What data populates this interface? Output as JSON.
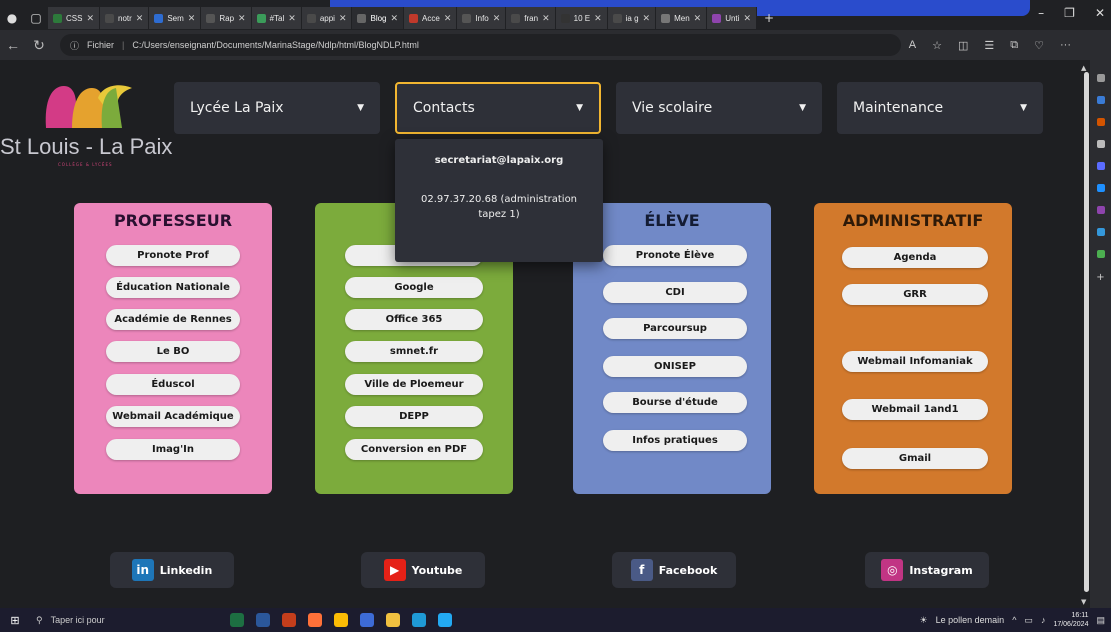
{
  "browser": {
    "tabs": [
      {
        "label": "CSS",
        "color": "#2d7a3b"
      },
      {
        "label": "notr",
        "color": "#4a4a4a"
      },
      {
        "label": "Sem",
        "color": "#2e6cd1"
      },
      {
        "label": "Rap",
        "color": "#555"
      },
      {
        "label": "#Tal",
        "color": "#3b9c5a"
      },
      {
        "label": "appi",
        "color": "#4a4a4a"
      },
      {
        "label": "Blog",
        "color": "#666",
        "active": true
      },
      {
        "label": "Acce",
        "color": "#c0392b"
      },
      {
        "label": "Info",
        "color": "#555"
      },
      {
        "label": "fran",
        "color": "#4a4a4a"
      },
      {
        "label": "10 E",
        "color": "#333"
      },
      {
        "label": "ia g",
        "color": "#4a4a4a"
      },
      {
        "label": "Men",
        "color": "#777"
      },
      {
        "label": "Unti",
        "color": "#8e44ad"
      }
    ],
    "new_tab": "+",
    "address": {
      "prefix": "Fichier",
      "path": "C:/Users/enseignant/Documents/MarinaStage/Ndlp/html/BlogNDLP.html"
    }
  },
  "site": {
    "logo_text": "St Louis - La Paix",
    "logo_sub": "COLLÈGE & LYCÉES",
    "menus": [
      {
        "label": "Lycée La Paix",
        "open": false
      },
      {
        "label": "Contacts",
        "open": true
      },
      {
        "label": "Vie scolaire",
        "open": false
      },
      {
        "label": "Maintenance",
        "open": false
      }
    ],
    "contacts_dropdown": {
      "email": "secretariat@lapaix.org",
      "phone": "02.97.37.20.68 (administration tapez 1)"
    },
    "cards": [
      {
        "title": "PROFESSEUR",
        "color": "#ec86bb",
        "title_color": "#2a1030",
        "items": [
          "Pronote Prof",
          "Éducation Nationale",
          "Académie de Rennes",
          "Le BO",
          "Éduscol",
          "Webmail Académique",
          "Imag'In"
        ]
      },
      {
        "title": "SE",
        "color": "#7cab3c",
        "title_color": "#1c2a10",
        "items": [
          "",
          "Google",
          "Office 365",
          "smnet.fr",
          "Ville de Ploemeur",
          "DEPP",
          "Conversion en PDF"
        ]
      },
      {
        "title": "ÉLÈVE",
        "color": "#7189c7",
        "title_color": "#141c34",
        "items": [
          "Pronote Élève",
          "CDI",
          "Parcoursup",
          "ONISEP",
          "Bourse d'étude",
          "Infos pratiques"
        ]
      },
      {
        "title": "ADMINISTRATIF",
        "color": "#d2792c",
        "title_color": "#2e1a08",
        "items": [
          "Agenda",
          "GRR",
          "Webmail Infomaniak",
          "Webmail 1and1",
          "Gmail"
        ]
      }
    ],
    "socials": [
      {
        "label": "Linkedin",
        "icon": "linkedin-icon",
        "glyph": "in",
        "color": "#1e76b8"
      },
      {
        "label": "Youtube",
        "icon": "youtube-icon",
        "glyph": "▶",
        "color": "#e52117"
      },
      {
        "label": "Facebook",
        "icon": "facebook-icon",
        "glyph": "f",
        "color": "#4a5a86"
      },
      {
        "label": "Instagram",
        "icon": "instagram-icon",
        "glyph": "◎",
        "color": "#c13584"
      }
    ]
  },
  "taskbar": {
    "search_placeholder": "Taper ici pour",
    "weather": "Le pollen demain",
    "time": "16:11",
    "date": "17/06/2024"
  }
}
